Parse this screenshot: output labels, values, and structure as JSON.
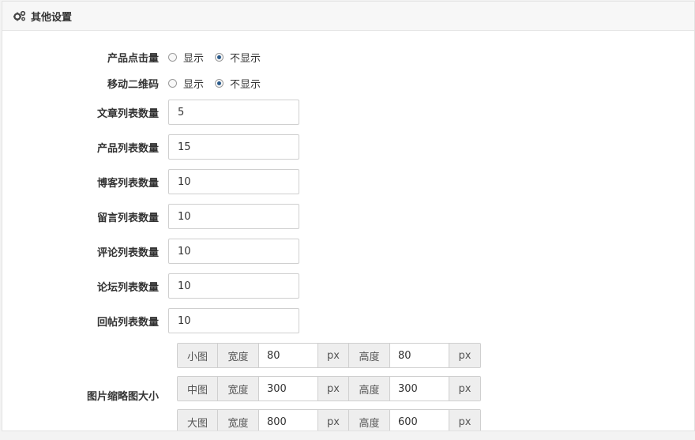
{
  "panel": {
    "title": "其他设置",
    "icon": "gears-icon"
  },
  "radio_rows": [
    {
      "label": "产品点击量",
      "options": [
        "显示",
        "不显示"
      ],
      "selected": "不显示"
    },
    {
      "label": "移动二维码",
      "options": [
        "显示",
        "不显示"
      ],
      "selected": "不显示"
    }
  ],
  "count_fields": [
    {
      "label": "文章列表数量",
      "value": "5"
    },
    {
      "label": "产品列表数量",
      "value": "15"
    },
    {
      "label": "博客列表数量",
      "value": "10"
    },
    {
      "label": "留言列表数量",
      "value": "10"
    },
    {
      "label": "评论列表数量",
      "value": "10"
    },
    {
      "label": "论坛列表数量",
      "value": "10"
    },
    {
      "label": "回帖列表数量",
      "value": "10"
    }
  ],
  "thumbnail": {
    "label": "图片缩略图大小",
    "width_label": "宽度",
    "height_label": "高度",
    "unit": "px",
    "sizes": [
      {
        "name": "小图",
        "width": "80",
        "height": "80"
      },
      {
        "name": "中图",
        "width": "300",
        "height": "300"
      },
      {
        "name": "大图",
        "width": "800",
        "height": "600"
      }
    ]
  }
}
